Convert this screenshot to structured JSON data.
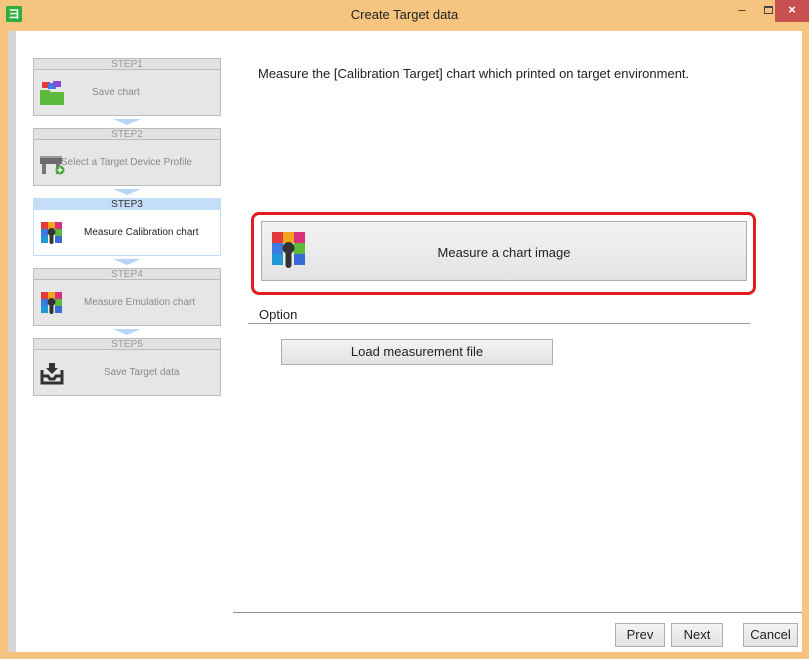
{
  "window": {
    "title": "Create Target data",
    "app_icon_glyph": "ヨ"
  },
  "controls": {
    "minimize": "–",
    "close": "×"
  },
  "steps": [
    {
      "head": "STEP1",
      "label": "Save chart",
      "icon": "folder-chart-icon"
    },
    {
      "head": "STEP2",
      "label": "Select a Target Device Profile",
      "icon": "printer-add-icon"
    },
    {
      "head": "STEP3",
      "label": "Measure Calibration chart",
      "icon": "color-chart-measure-icon",
      "active": true
    },
    {
      "head": "STEP4",
      "label": "Measure Emulation chart",
      "icon": "color-chart-measure-icon"
    },
    {
      "head": "STEP5",
      "label": "Save Target data",
      "icon": "tray-save-icon"
    }
  ],
  "main": {
    "instruction": "Measure the [Calibration Target] chart which printed on target environment.",
    "measure_button": "Measure a chart image",
    "option_label": "Option",
    "load_button": "Load measurement file"
  },
  "footer": {
    "prev": "Prev",
    "next": "Next",
    "cancel": "Cancel"
  },
  "colors": {
    "frame": "#f5c47f",
    "active_step": "#c4defa",
    "highlight": "#e11d1d",
    "close_button": "#c75050"
  }
}
